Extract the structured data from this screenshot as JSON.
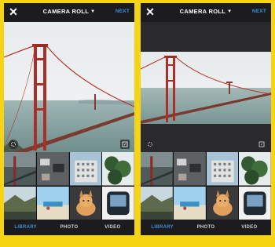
{
  "screens": [
    {
      "header": {
        "title": "CAMERA ROLL",
        "next_label": "NEXT",
        "close_icon": "close-icon",
        "dropdown_icon": "chevron-down-icon"
      },
      "preview": {
        "mode": "square-crop"
      },
      "tabs": [
        {
          "label": "LIBRARY",
          "active": true
        },
        {
          "label": "PHOTO",
          "active": false
        },
        {
          "label": "VIDEO",
          "active": false
        }
      ]
    },
    {
      "header": {
        "title": "CAMERA ROLL",
        "next_label": "NEXT",
        "close_icon": "close-icon",
        "dropdown_icon": "chevron-down-icon"
      },
      "preview": {
        "mode": "full-landscape"
      },
      "tabs": [
        {
          "label": "LIBRARY",
          "active": true
        },
        {
          "label": "PHOTO",
          "active": false
        },
        {
          "label": "VIDEO",
          "active": false
        }
      ]
    }
  ],
  "colors": {
    "frame": "#f6d313",
    "ui_dark": "#1c1c1e",
    "accent": "#3b8fd8",
    "bridge": "#b5362a"
  }
}
